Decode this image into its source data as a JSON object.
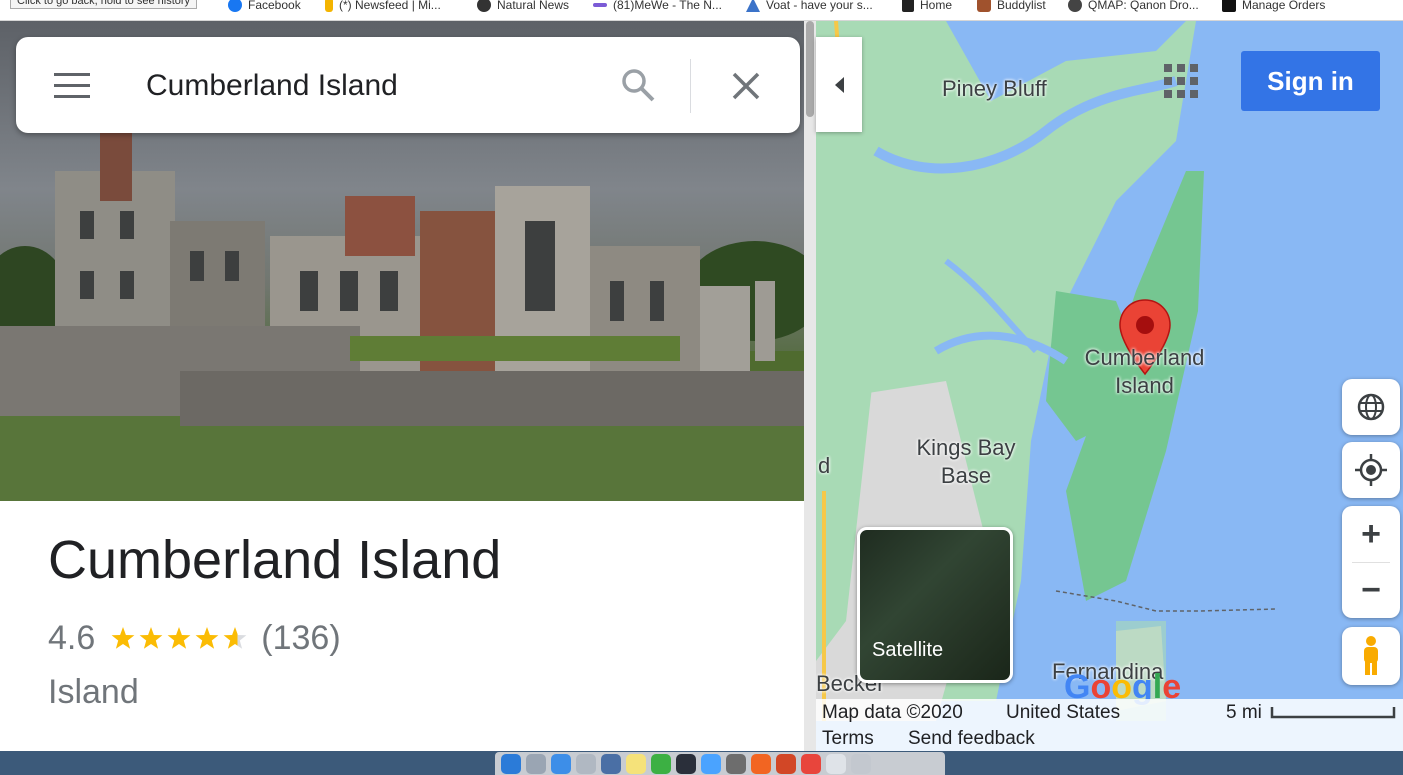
{
  "bookmarks": {
    "tooltip": "Click to go back, hold to see history",
    "items": [
      {
        "label": "Facebook",
        "color": "#1877f2"
      },
      {
        "label": "(*) Newsfeed | Mi...",
        "color": "#f4b400"
      },
      {
        "label": "Natural News",
        "color": "#333333"
      },
      {
        "label": "(81)MeWe - The N...",
        "color": "#7b5bd6"
      },
      {
        "label": "Voat - have your s...",
        "color": "#3b73c9"
      },
      {
        "label": "Home",
        "color": "#222222"
      },
      {
        "label": "Buddylist",
        "color": "#a0522d"
      },
      {
        "label": "QMAP: Qanon Dro...",
        "color": "#444444"
      },
      {
        "label": "Manage Orders",
        "color": "#111111"
      }
    ]
  },
  "search": {
    "value": "Cumberland Island",
    "menu_icon": "hamburger-menu-icon",
    "search_icon": "search-icon",
    "close_icon": "close-icon"
  },
  "place": {
    "title": "Cumberland Island",
    "rating": "4.6",
    "stars": 4.6,
    "reviews": "(136)",
    "category": "Island"
  },
  "map": {
    "labels": {
      "piney_bluff": "Piney Bluff",
      "cumberland": "Cumberland Island",
      "kings_bay": "Kings Bay Base",
      "partial_d": "d",
      "becker": "Becker",
      "fernandina": "Fernandina"
    },
    "sign_in": "Sign in",
    "satellite_label": "Satellite",
    "attribution": {
      "map_data": "Map data ©2020",
      "country": "United States",
      "scale": "5 mi",
      "terms": "Terms",
      "feedback": "Send feedback"
    },
    "controls": {
      "zoom_in": "+",
      "zoom_out": "−"
    },
    "colors": {
      "water": "#89b8f4",
      "land": "#a8dab5",
      "marker": "#ea4335",
      "button": "#3374e6"
    }
  }
}
